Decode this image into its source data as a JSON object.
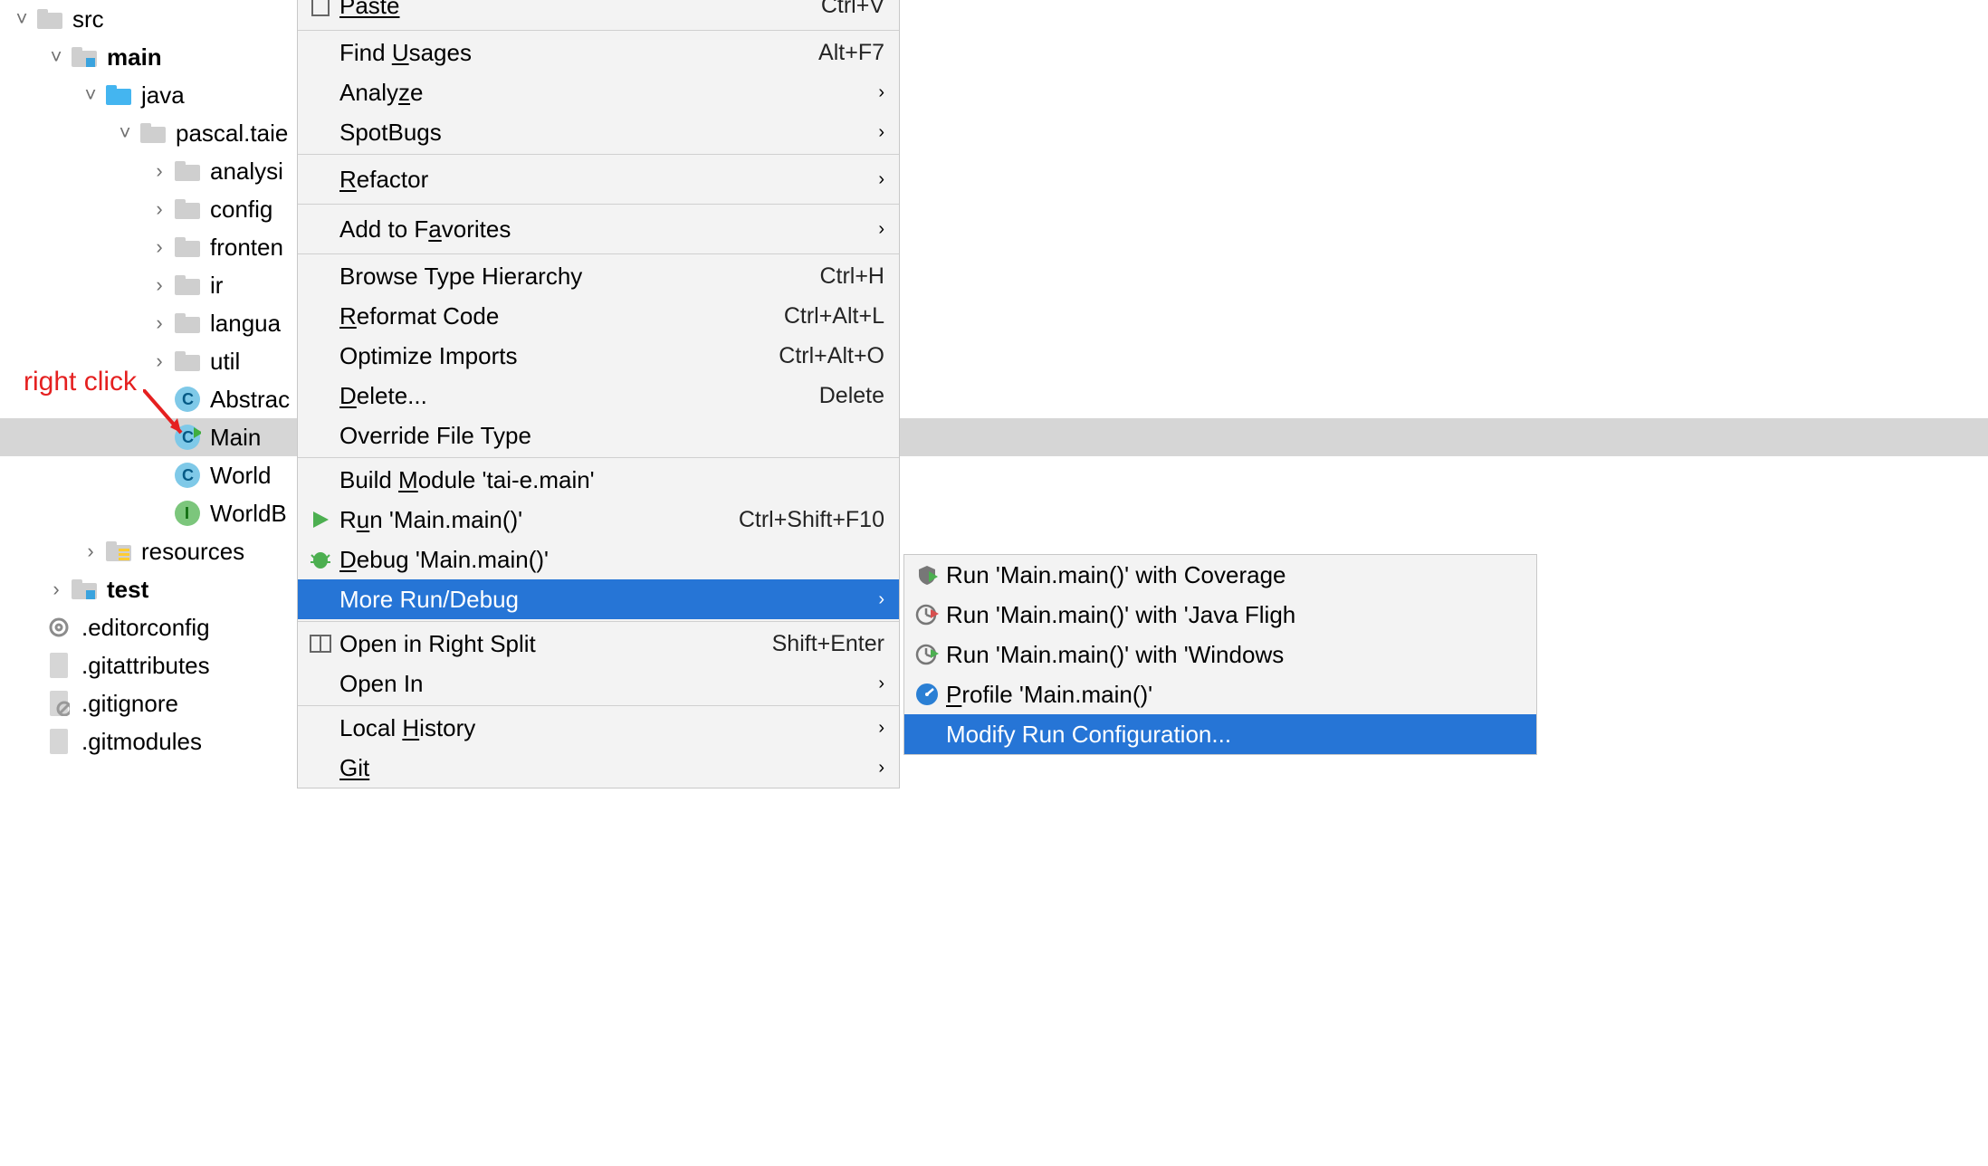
{
  "tree": {
    "src": "src",
    "main": "main",
    "java": "java",
    "pkg": "pascal.taie",
    "analysis": "analysi",
    "config": "config",
    "frontend": "fronten",
    "ir": "ir",
    "language": "langua",
    "util": "util",
    "abstract": "Abstrac",
    "main_cls": "Main",
    "world": "World",
    "worldb": "WorldB",
    "resources": "resources",
    "test": "test",
    "editorconfig": ".editorconfig",
    "gitattributes": ".gitattributes",
    "gitignore": ".gitignore",
    "gitmodules": ".gitmodules"
  },
  "arrows": {
    "down": "˅",
    "right": "›"
  },
  "ctx": {
    "paste": "Paste",
    "paste_sc": "Ctrl+V",
    "find_usages_pre": "Find ",
    "find_usages_u": "U",
    "find_usages_post": "sages",
    "find_usages_sc": "Alt+F7",
    "analyze_pre": "Analy",
    "analyze_u": "z",
    "analyze_post": "e",
    "spotbugs": "SpotBugs",
    "refactor_u": "R",
    "refactor_post": "efactor",
    "favorites_pre": "Add to F",
    "favorites_u": "a",
    "favorites_post": "vorites",
    "browse_hier": "Browse Type Hierarchy",
    "browse_hier_sc": "Ctrl+H",
    "reformat_u": "R",
    "reformat_post": "eformat Code",
    "reformat_sc": "Ctrl+Alt+L",
    "optimize": "Optimize Imports",
    "optimize_sc": "Ctrl+Alt+O",
    "delete_u": "D",
    "delete_post": "elete...",
    "delete_sc": "Delete",
    "override": "Override File Type",
    "build_pre": "Build ",
    "build_u": "M",
    "build_post": "odule 'tai-e.main'",
    "run_pre": "R",
    "run_u": "u",
    "run_post": "n 'Main.main()'",
    "run_sc": "Ctrl+Shift+F10",
    "debug_u": "D",
    "debug_post": "ebug 'Main.main()'",
    "more": "More Run/Debug",
    "open_split": "Open in Right Split",
    "open_split_sc": "Shift+Enter",
    "open_in": "Open In",
    "local_hist_pre": "Local ",
    "local_hist_u": "H",
    "local_hist_post": "istory",
    "git": "Git"
  },
  "sub": {
    "coverage": "Run 'Main.main()' with Coverage",
    "flight": "Run 'Main.main()' with 'Java Fligh",
    "windows": "Run 'Main.main()' with 'Windows",
    "profile_u": "P",
    "profile_post": "rofile 'Main.main()'",
    "modify": "Modify Run Configuration..."
  },
  "anno": "right click"
}
